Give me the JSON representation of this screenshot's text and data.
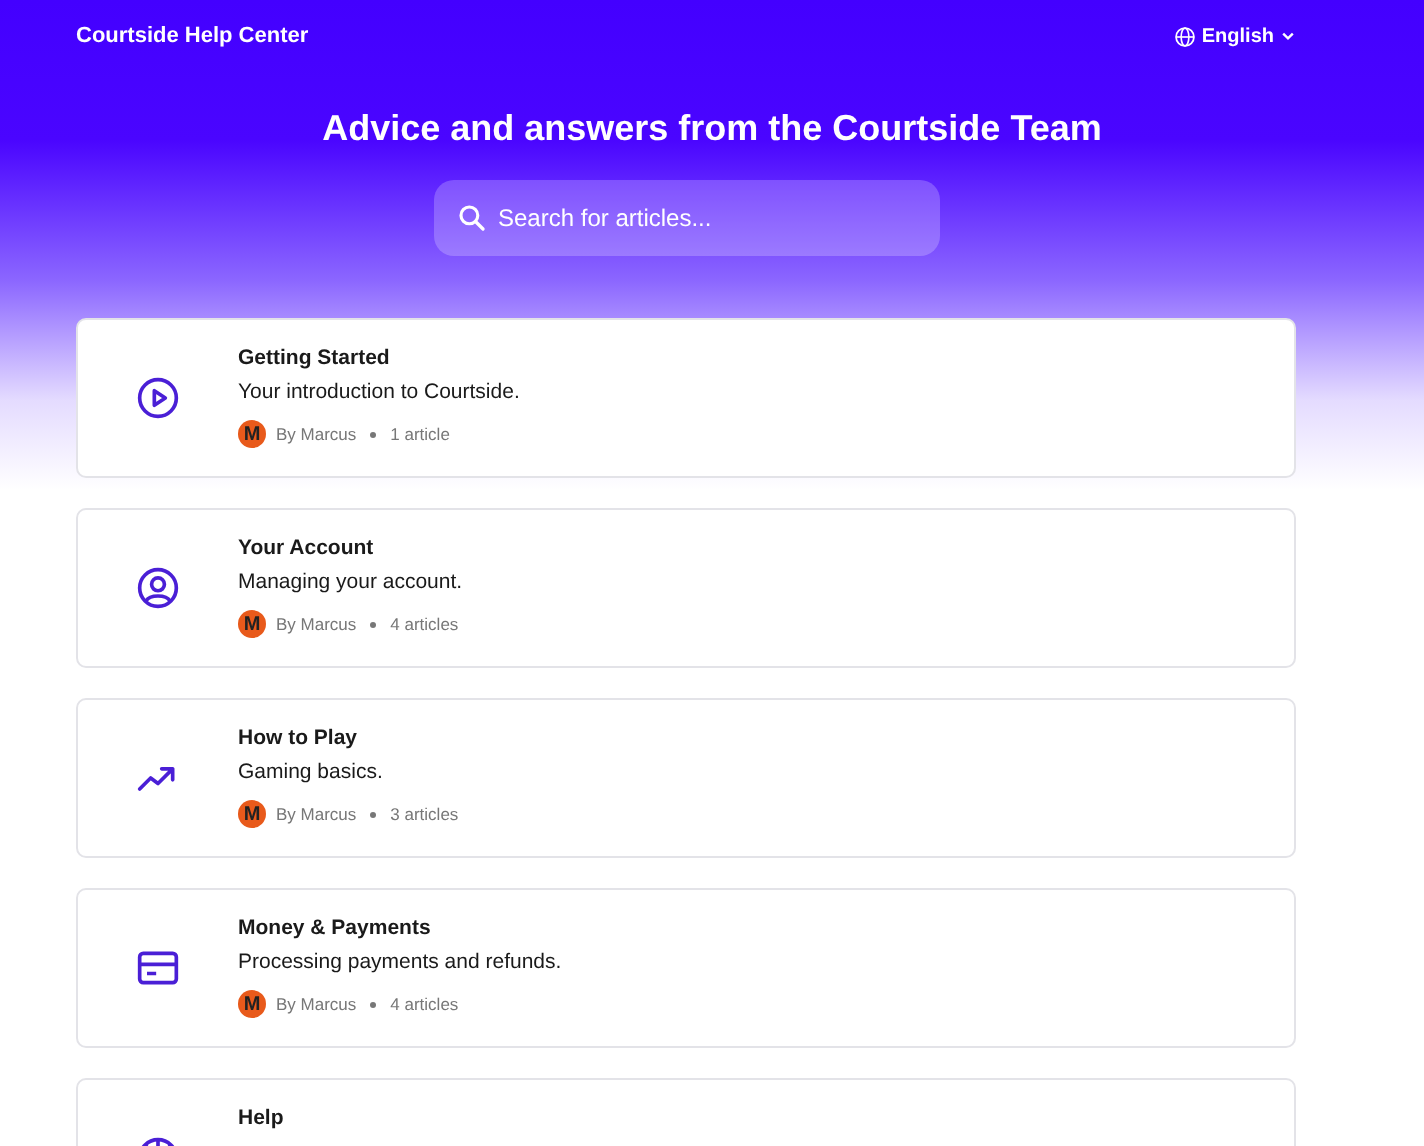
{
  "header": {
    "site_title": "Courtside Help Center",
    "language": "English"
  },
  "hero": {
    "heading": "Advice and answers from the Courtside Team",
    "search": {
      "placeholder": "Search for articles..."
    }
  },
  "collections": [
    {
      "kind": "play",
      "title": "Getting Started",
      "description": "Your introduction to Courtside.",
      "avatar_letter": "M",
      "author": "By Marcus",
      "count": "1 article"
    },
    {
      "kind": "user",
      "title": "Your Account",
      "description": "Managing your account.",
      "avatar_letter": "M",
      "author": "By Marcus",
      "count": "4 articles"
    },
    {
      "kind": "trend",
      "title": "How to Play",
      "description": "Gaming basics.",
      "avatar_letter": "M",
      "author": "By Marcus",
      "count": "3 articles"
    },
    {
      "kind": "card",
      "title": "Money & Payments",
      "description": "Processing payments and refunds.",
      "avatar_letter": "M",
      "author": "By Marcus",
      "count": "4 articles"
    },
    {
      "kind": "ball",
      "title": "Help"
    }
  ]
}
